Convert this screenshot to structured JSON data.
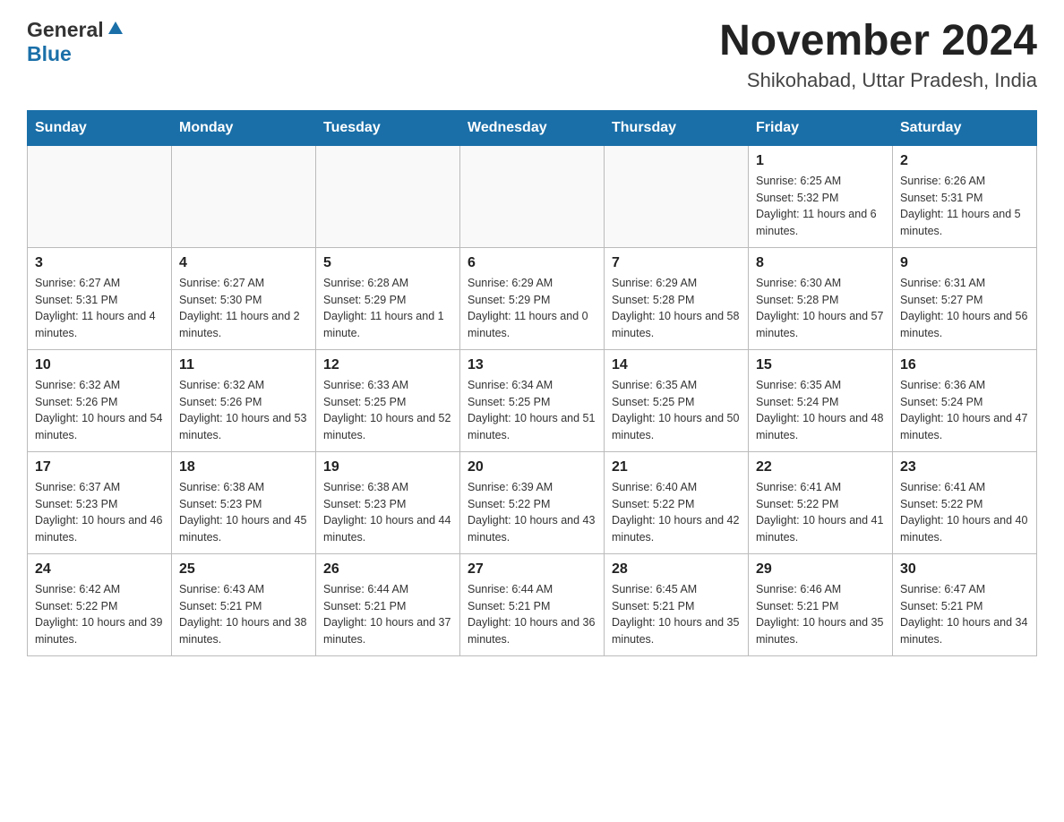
{
  "header": {
    "logo_general": "General",
    "logo_blue": "Blue",
    "title": "November 2024",
    "subtitle": "Shikohabad, Uttar Pradesh, India"
  },
  "weekdays": [
    "Sunday",
    "Monday",
    "Tuesday",
    "Wednesday",
    "Thursday",
    "Friday",
    "Saturday"
  ],
  "weeks": [
    [
      {
        "day": "",
        "info": ""
      },
      {
        "day": "",
        "info": ""
      },
      {
        "day": "",
        "info": ""
      },
      {
        "day": "",
        "info": ""
      },
      {
        "day": "",
        "info": ""
      },
      {
        "day": "1",
        "info": "Sunrise: 6:25 AM\nSunset: 5:32 PM\nDaylight: 11 hours and 6 minutes."
      },
      {
        "day": "2",
        "info": "Sunrise: 6:26 AM\nSunset: 5:31 PM\nDaylight: 11 hours and 5 minutes."
      }
    ],
    [
      {
        "day": "3",
        "info": "Sunrise: 6:27 AM\nSunset: 5:31 PM\nDaylight: 11 hours and 4 minutes."
      },
      {
        "day": "4",
        "info": "Sunrise: 6:27 AM\nSunset: 5:30 PM\nDaylight: 11 hours and 2 minutes."
      },
      {
        "day": "5",
        "info": "Sunrise: 6:28 AM\nSunset: 5:29 PM\nDaylight: 11 hours and 1 minute."
      },
      {
        "day": "6",
        "info": "Sunrise: 6:29 AM\nSunset: 5:29 PM\nDaylight: 11 hours and 0 minutes."
      },
      {
        "day": "7",
        "info": "Sunrise: 6:29 AM\nSunset: 5:28 PM\nDaylight: 10 hours and 58 minutes."
      },
      {
        "day": "8",
        "info": "Sunrise: 6:30 AM\nSunset: 5:28 PM\nDaylight: 10 hours and 57 minutes."
      },
      {
        "day": "9",
        "info": "Sunrise: 6:31 AM\nSunset: 5:27 PM\nDaylight: 10 hours and 56 minutes."
      }
    ],
    [
      {
        "day": "10",
        "info": "Sunrise: 6:32 AM\nSunset: 5:26 PM\nDaylight: 10 hours and 54 minutes."
      },
      {
        "day": "11",
        "info": "Sunrise: 6:32 AM\nSunset: 5:26 PM\nDaylight: 10 hours and 53 minutes."
      },
      {
        "day": "12",
        "info": "Sunrise: 6:33 AM\nSunset: 5:25 PM\nDaylight: 10 hours and 52 minutes."
      },
      {
        "day": "13",
        "info": "Sunrise: 6:34 AM\nSunset: 5:25 PM\nDaylight: 10 hours and 51 minutes."
      },
      {
        "day": "14",
        "info": "Sunrise: 6:35 AM\nSunset: 5:25 PM\nDaylight: 10 hours and 50 minutes."
      },
      {
        "day": "15",
        "info": "Sunrise: 6:35 AM\nSunset: 5:24 PM\nDaylight: 10 hours and 48 minutes."
      },
      {
        "day": "16",
        "info": "Sunrise: 6:36 AM\nSunset: 5:24 PM\nDaylight: 10 hours and 47 minutes."
      }
    ],
    [
      {
        "day": "17",
        "info": "Sunrise: 6:37 AM\nSunset: 5:23 PM\nDaylight: 10 hours and 46 minutes."
      },
      {
        "day": "18",
        "info": "Sunrise: 6:38 AM\nSunset: 5:23 PM\nDaylight: 10 hours and 45 minutes."
      },
      {
        "day": "19",
        "info": "Sunrise: 6:38 AM\nSunset: 5:23 PM\nDaylight: 10 hours and 44 minutes."
      },
      {
        "day": "20",
        "info": "Sunrise: 6:39 AM\nSunset: 5:22 PM\nDaylight: 10 hours and 43 minutes."
      },
      {
        "day": "21",
        "info": "Sunrise: 6:40 AM\nSunset: 5:22 PM\nDaylight: 10 hours and 42 minutes."
      },
      {
        "day": "22",
        "info": "Sunrise: 6:41 AM\nSunset: 5:22 PM\nDaylight: 10 hours and 41 minutes."
      },
      {
        "day": "23",
        "info": "Sunrise: 6:41 AM\nSunset: 5:22 PM\nDaylight: 10 hours and 40 minutes."
      }
    ],
    [
      {
        "day": "24",
        "info": "Sunrise: 6:42 AM\nSunset: 5:22 PM\nDaylight: 10 hours and 39 minutes."
      },
      {
        "day": "25",
        "info": "Sunrise: 6:43 AM\nSunset: 5:21 PM\nDaylight: 10 hours and 38 minutes."
      },
      {
        "day": "26",
        "info": "Sunrise: 6:44 AM\nSunset: 5:21 PM\nDaylight: 10 hours and 37 minutes."
      },
      {
        "day": "27",
        "info": "Sunrise: 6:44 AM\nSunset: 5:21 PM\nDaylight: 10 hours and 36 minutes."
      },
      {
        "day": "28",
        "info": "Sunrise: 6:45 AM\nSunset: 5:21 PM\nDaylight: 10 hours and 35 minutes."
      },
      {
        "day": "29",
        "info": "Sunrise: 6:46 AM\nSunset: 5:21 PM\nDaylight: 10 hours and 35 minutes."
      },
      {
        "day": "30",
        "info": "Sunrise: 6:47 AM\nSunset: 5:21 PM\nDaylight: 10 hours and 34 minutes."
      }
    ]
  ]
}
